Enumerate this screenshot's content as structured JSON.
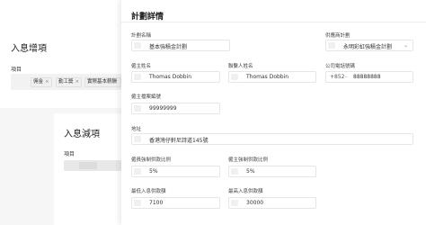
{
  "background": {
    "section1_title": "入息增項",
    "section1_label": "項目",
    "tags": [
      {
        "label": "佣金",
        "remove": "×"
      },
      {
        "label": "勤工獎",
        "remove": "×"
      },
      {
        "label": "實際基本薪酬",
        "remove": ""
      }
    ],
    "section2_title": "入息減項",
    "section2_label": "項目"
  },
  "modal": {
    "title": "計劃詳情",
    "plan_name": {
      "label": "計劃名稱",
      "value": "基本強積金計劃"
    },
    "provider_plan": {
      "label": "供應商計劃",
      "value": "永明彩虹強積金計劃",
      "chevron": "⌄"
    },
    "employer_name": {
      "label": "僱主姓名",
      "value": "Thomas Dobbin"
    },
    "contact_name": {
      "label": "聯繫人姓名",
      "value": "Thomas Dobbin"
    },
    "company_phone": {
      "label": "公司電話號碼",
      "prefix": "+852",
      "prefix_chevron": "⌄",
      "value": "88888888"
    },
    "employer_account": {
      "label": "僱主檔案編號",
      "value": "99999999"
    },
    "address": {
      "label": "地址",
      "value": "香港灣仔軒尼詩道145號"
    },
    "employee_rate": {
      "label": "僱員強制供款比例",
      "value": "5%"
    },
    "employer_rate": {
      "label": "僱主強制供款比例",
      "value": "5%"
    },
    "min_income": {
      "label": "最低入息供款額",
      "value": "7100"
    },
    "max_income": {
      "label": "最高入息供款額",
      "value": "30000"
    }
  }
}
